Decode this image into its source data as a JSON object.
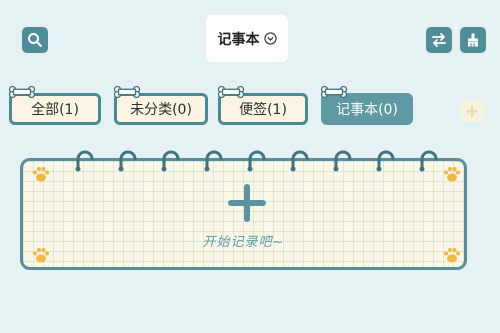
{
  "header": {
    "title": "记事本",
    "icons": {
      "search": "search-icon",
      "title_dropdown": "chevron-down-circle-icon",
      "swap": "swap-arrows-icon",
      "clean": "brush-icon"
    }
  },
  "tabs": [
    {
      "label": "全部(1)",
      "active": false
    },
    {
      "label": "未分类(0)",
      "active": false
    },
    {
      "label": "便签(1)",
      "active": false
    },
    {
      "label": "记事本(0)",
      "active": true
    }
  ],
  "add_tab": {
    "label": "+"
  },
  "notebook": {
    "empty_hint": "开始记录吧~",
    "icons": {
      "add": "plus-icon",
      "corner": "paw-icon",
      "tab_decor": "bone-icon"
    }
  },
  "colors": {
    "background": "#e6f1f4",
    "primary": "#4f8d98",
    "active_tab": "#5e99a4",
    "paper": "#fbf7e6",
    "paw": "#f2b93f",
    "hint_text": "#5b9fa9"
  }
}
